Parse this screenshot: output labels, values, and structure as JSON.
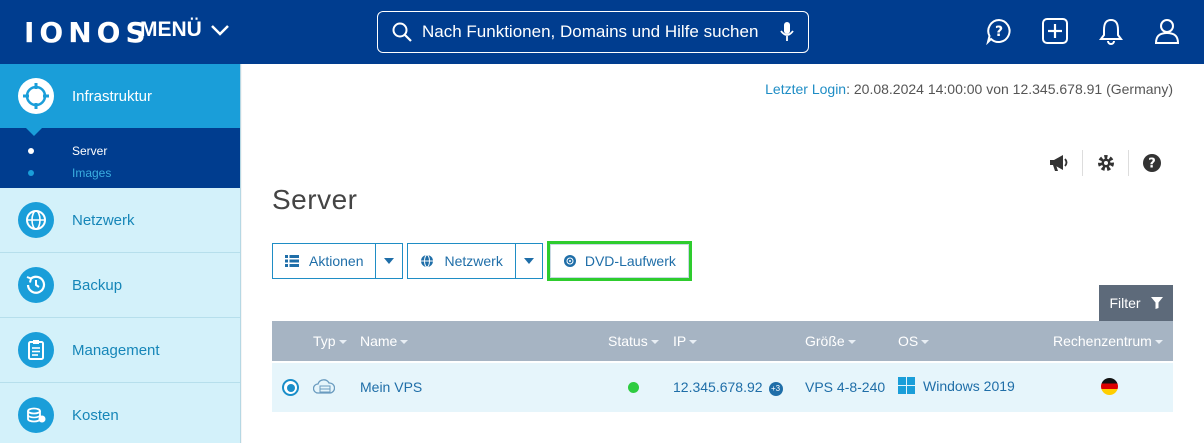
{
  "header": {
    "logo": "IONOS",
    "menu_label": "MENÜ",
    "search_placeholder": "Nach Funktionen, Domains und Hilfe suchen",
    "icons": [
      "help-chat-icon",
      "add-icon",
      "bell-icon",
      "user-icon"
    ],
    "bg_color": "#003d8f"
  },
  "sidebar": {
    "active": {
      "label": "Infrastruktur",
      "icon": "infrastructure-icon"
    },
    "sub_items": [
      {
        "label": "Server",
        "active": true
      },
      {
        "label": "Images",
        "active": false
      }
    ],
    "items": [
      {
        "label": "Netzwerk",
        "icon": "network-globe-icon"
      },
      {
        "label": "Backup",
        "icon": "backup-clock-icon"
      },
      {
        "label": "Management",
        "icon": "clipboard-icon"
      },
      {
        "label": "Kosten",
        "icon": "coins-icon"
      }
    ]
  },
  "main": {
    "last_login_link": "Letzter Login",
    "last_login_text": ": 20.08.2024 14:00:00 von 12.345.678.91 (Germany)",
    "title": "Server",
    "buttons": {
      "actions": "Aktionen",
      "network": "Netzwerk",
      "dvd": "DVD-Laufwerk"
    },
    "filter_label": "Filter",
    "table": {
      "headers": [
        "Typ",
        "Name",
        "Status",
        "IP",
        "Größe",
        "OS",
        "Rechenzentrum"
      ],
      "rows": [
        {
          "type_icon": "cloud-server-icon",
          "name": "Mein VPS",
          "status": "online",
          "ip": "12.345.678.92",
          "ip_badge": "+3",
          "size": "VPS 4-8-240",
          "os": "Windows 2019",
          "datacenter_flag": "germany-flag-icon"
        }
      ]
    }
  },
  "colors": {
    "accent": "#1a9ed9",
    "highlight_border": "#2ecc2e",
    "status_online": "#2ecc40"
  }
}
